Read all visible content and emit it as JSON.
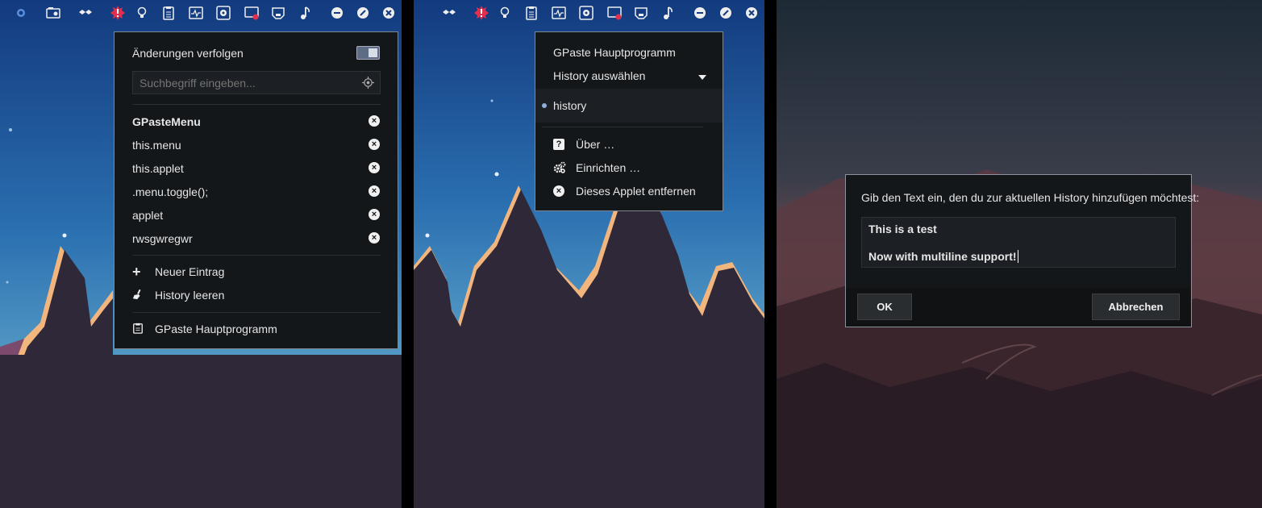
{
  "panel1": {
    "menu": {
      "track_label": "Änderungen verfolgen",
      "track_enabled": true,
      "search_placeholder": "Suchbegriff eingeben...",
      "history_items": [
        {
          "text": "GPasteMenu",
          "bold": true
        },
        {
          "text": "this.menu",
          "bold": false
        },
        {
          "text": "this.applet",
          "bold": false
        },
        {
          "text": ".menu.toggle();",
          "bold": false
        },
        {
          "text": "applet",
          "bold": false
        },
        {
          "text": "rwsgwregwr",
          "bold": false
        }
      ],
      "new_entry_label": "Neuer Eintrag",
      "clear_history_label": "History leeren",
      "main_program_label": "GPaste Hauptprogramm",
      "close_glyph": "×",
      "plus_glyph": "+"
    }
  },
  "panel2": {
    "menu": {
      "title": "GPaste Hauptprogramm",
      "select_history_label": "History auswählen",
      "history_name": "history",
      "about_label": "Über …",
      "configure_label": "Einrichten …",
      "remove_label": "Dieses Applet entfernen",
      "about_glyph": "?",
      "remove_glyph": "×"
    }
  },
  "panel3": {
    "dialog": {
      "prompt": "Gib den Text ein, den du zur aktuellen History hinzufügen möchtest:",
      "text_line1": "This is a test",
      "text_line2": "Now with multiline support!",
      "ok_label": "OK",
      "cancel_label": "Abbrechen"
    }
  },
  "colors": {
    "menu_bg": "#14171a",
    "menu_border": "#7e8792",
    "accent_red": "#e0304e",
    "tree": "#2f2838",
    "highlight_edge": "#f2b57d"
  }
}
